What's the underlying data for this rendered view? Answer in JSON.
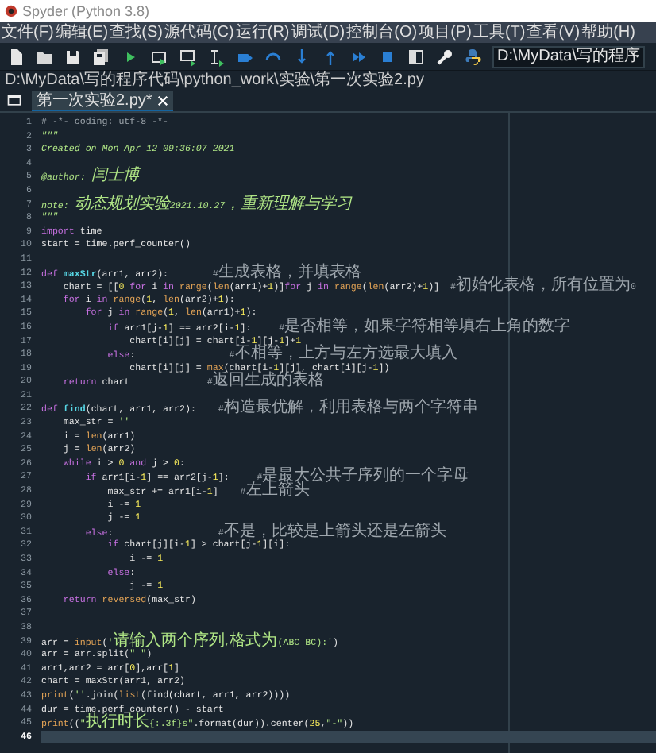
{
  "window": {
    "title": "Spyder (Python 3.8)"
  },
  "menu": [
    "文件(F)",
    "编辑(E)",
    "查找(S)",
    "源代码(C)",
    "运行(R)",
    "调试(D)",
    "控制台(O)",
    "项目(P)",
    "工具(T)",
    "查看(V)",
    "帮助(H)"
  ],
  "toolbar": {
    "working_directory": "D:\\MyData\\写的程序"
  },
  "file_path": "D:\\MyData\\写的程序代码\\python_work\\实验\\第一次实验2.py",
  "tabs": [
    {
      "label": "第一次实验2.py*",
      "selected": true
    }
  ],
  "editor": {
    "lines": [
      {
        "number": "1",
        "current": false,
        "tokens": [
          {
            "kind": "comment",
            "text": "# -*- coding: utf-8 -*-"
          }
        ]
      },
      {
        "number": "2",
        "current": false,
        "tokens": [
          {
            "kind": "docstring",
            "text": "\"\"\""
          }
        ]
      },
      {
        "number": "3",
        "current": false,
        "tokens": [
          {
            "kind": "docstring",
            "text": "Created on Mon Apr 12 09:36:07 2021"
          }
        ]
      },
      {
        "number": "4",
        "current": false
      },
      {
        "number": "5",
        "current": false,
        "tokens": [
          {
            "kind": "docstring",
            "text": "@author: 闫士博"
          }
        ]
      },
      {
        "number": "6",
        "current": false
      },
      {
        "number": "7",
        "current": false,
        "tokens": [
          {
            "kind": "docstring",
            "text": "note: 动态规划实验2021.10.27，重新理解与学习"
          }
        ]
      },
      {
        "number": "8",
        "current": false,
        "tokens": [
          {
            "kind": "docstring",
            "text": "\"\"\""
          }
        ]
      },
      {
        "number": "9",
        "current": false,
        "tokens": [
          {
            "kind": "keyword",
            "text": "import"
          },
          {
            "kind": "plain",
            "text": " time"
          }
        ]
      },
      {
        "number": "10",
        "current": false,
        "tokens": [
          {
            "kind": "plain",
            "text": "start = time.perf_counter()"
          }
        ]
      },
      {
        "number": "11",
        "current": false
      },
      {
        "number": "12",
        "current": false,
        "tokens": [
          {
            "kind": "keyword",
            "text": "def "
          },
          {
            "kind": "function",
            "text": "maxStr"
          },
          {
            "kind": "plain",
            "text": "(arr1, arr2):        "
          },
          {
            "kind": "comment",
            "text": "#生成表格，并填表格"
          }
        ]
      },
      {
        "number": "13",
        "current": false,
        "tokens": [
          {
            "kind": "plain",
            "text": "    chart = [["
          },
          {
            "kind": "number",
            "text": "0"
          },
          {
            "kind": "keyword",
            "text": " for"
          },
          {
            "kind": "plain",
            "text": " i "
          },
          {
            "kind": "keyword",
            "text": "in"
          },
          {
            "kind": "builtin",
            "text": " range"
          },
          {
            "kind": "plain",
            "text": "("
          },
          {
            "kind": "builtin",
            "text": "len"
          },
          {
            "kind": "plain",
            "text": "(arr1)+"
          },
          {
            "kind": "number",
            "text": "1"
          },
          {
            "kind": "plain",
            "text": ")]"
          },
          {
            "kind": "keyword",
            "text": "for"
          },
          {
            "kind": "plain",
            "text": " j "
          },
          {
            "kind": "keyword",
            "text": "in"
          },
          {
            "kind": "builtin",
            "text": " range"
          },
          {
            "kind": "plain",
            "text": "("
          },
          {
            "kind": "builtin",
            "text": "len"
          },
          {
            "kind": "plain",
            "text": "(arr2)+"
          },
          {
            "kind": "number",
            "text": "1"
          },
          {
            "kind": "plain",
            "text": ")]  "
          },
          {
            "kind": "comment",
            "text": "#初始化表格，所有位置为0"
          }
        ]
      },
      {
        "number": "14",
        "current": false,
        "tokens": [
          {
            "kind": "keyword",
            "text": "    for"
          },
          {
            "kind": "plain",
            "text": " i "
          },
          {
            "kind": "keyword",
            "text": "in"
          },
          {
            "kind": "builtin",
            "text": " range"
          },
          {
            "kind": "plain",
            "text": "("
          },
          {
            "kind": "number",
            "text": "1"
          },
          {
            "kind": "plain",
            "text": ", "
          },
          {
            "kind": "builtin",
            "text": "len"
          },
          {
            "kind": "plain",
            "text": "(arr2)+"
          },
          {
            "kind": "number",
            "text": "1"
          },
          {
            "kind": "plain",
            "text": "):"
          }
        ]
      },
      {
        "number": "15",
        "current": false,
        "tokens": [
          {
            "kind": "keyword",
            "text": "        for"
          },
          {
            "kind": "plain",
            "text": " j "
          },
          {
            "kind": "keyword",
            "text": "in"
          },
          {
            "kind": "builtin",
            "text": " range"
          },
          {
            "kind": "plain",
            "text": "("
          },
          {
            "kind": "number",
            "text": "1"
          },
          {
            "kind": "plain",
            "text": ", "
          },
          {
            "kind": "builtin",
            "text": "len"
          },
          {
            "kind": "plain",
            "text": "(arr1)+"
          },
          {
            "kind": "number",
            "text": "1"
          },
          {
            "kind": "plain",
            "text": "):"
          }
        ]
      },
      {
        "number": "16",
        "current": false,
        "tokens": [
          {
            "kind": "keyword",
            "text": "            if"
          },
          {
            "kind": "plain",
            "text": " arr1[j-"
          },
          {
            "kind": "number",
            "text": "1"
          },
          {
            "kind": "plain",
            "text": "] == arr2[i-"
          },
          {
            "kind": "number",
            "text": "1"
          },
          {
            "kind": "plain",
            "text": "]:     "
          },
          {
            "kind": "comment",
            "text": "#是否相等，如果字符相等填右上角的数字"
          }
        ]
      },
      {
        "number": "17",
        "current": false,
        "tokens": [
          {
            "kind": "plain",
            "text": "                chart[i][j] = chart[i-"
          },
          {
            "kind": "number",
            "text": "1"
          },
          {
            "kind": "plain",
            "text": "][j-"
          },
          {
            "kind": "number",
            "text": "1"
          },
          {
            "kind": "plain",
            "text": "]+"
          },
          {
            "kind": "number",
            "text": "1"
          }
        ]
      },
      {
        "number": "18",
        "current": false,
        "tokens": [
          {
            "kind": "keyword",
            "text": "            else"
          },
          {
            "kind": "plain",
            "text": ":                 "
          },
          {
            "kind": "comment",
            "text": "#不相等，上方与左方选最大填入"
          }
        ]
      },
      {
        "number": "19",
        "current": false,
        "tokens": [
          {
            "kind": "plain",
            "text": "                chart[i][j] = "
          },
          {
            "kind": "builtin",
            "text": "max"
          },
          {
            "kind": "plain",
            "text": "(chart[i-"
          },
          {
            "kind": "number",
            "text": "1"
          },
          {
            "kind": "plain",
            "text": "][j], chart[i][j-"
          },
          {
            "kind": "number",
            "text": "1"
          },
          {
            "kind": "plain",
            "text": "])"
          }
        ]
      },
      {
        "number": "20",
        "current": false,
        "tokens": [
          {
            "kind": "keyword",
            "text": "    return"
          },
          {
            "kind": "plain",
            "text": " chart              "
          },
          {
            "kind": "comment",
            "text": "#返回生成的表格"
          }
        ]
      },
      {
        "number": "21",
        "current": false
      },
      {
        "number": "22",
        "current": false,
        "tokens": [
          {
            "kind": "keyword",
            "text": "def "
          },
          {
            "kind": "function",
            "text": "find"
          },
          {
            "kind": "plain",
            "text": "(chart, arr1, arr2):    "
          },
          {
            "kind": "comment",
            "text": "#构造最优解，利用表格与两个字符串"
          }
        ]
      },
      {
        "number": "23",
        "current": false,
        "tokens": [
          {
            "kind": "plain",
            "text": "    max_str = "
          },
          {
            "kind": "string",
            "text": "''"
          }
        ]
      },
      {
        "number": "24",
        "current": false,
        "tokens": [
          {
            "kind": "plain",
            "text": "    i = "
          },
          {
            "kind": "builtin",
            "text": "len"
          },
          {
            "kind": "plain",
            "text": "(arr1)"
          }
        ]
      },
      {
        "number": "25",
        "current": false,
        "tokens": [
          {
            "kind": "plain",
            "text": "    j = "
          },
          {
            "kind": "builtin",
            "text": "len"
          },
          {
            "kind": "plain",
            "text": "(arr2)"
          }
        ]
      },
      {
        "number": "26",
        "current": false,
        "tokens": [
          {
            "kind": "keyword",
            "text": "    while"
          },
          {
            "kind": "plain",
            "text": " i > "
          },
          {
            "kind": "number",
            "text": "0"
          },
          {
            "kind": "keyword",
            "text": " and"
          },
          {
            "kind": "plain",
            "text": " j > "
          },
          {
            "kind": "number",
            "text": "0"
          },
          {
            "kind": "plain",
            "text": ":"
          }
        ]
      },
      {
        "number": "27",
        "current": false,
        "tokens": [
          {
            "kind": "keyword",
            "text": "        if"
          },
          {
            "kind": "plain",
            "text": " arr1[i-"
          },
          {
            "kind": "number",
            "text": "1"
          },
          {
            "kind": "plain",
            "text": "] == arr2[j-"
          },
          {
            "kind": "number",
            "text": "1"
          },
          {
            "kind": "plain",
            "text": "]:     "
          },
          {
            "kind": "comment",
            "text": "#是最大公共子序列的一个字母"
          }
        ]
      },
      {
        "number": "28",
        "current": false,
        "tokens": [
          {
            "kind": "plain",
            "text": "            max_str += arr1[i-"
          },
          {
            "kind": "number",
            "text": "1"
          },
          {
            "kind": "plain",
            "text": "]    "
          },
          {
            "kind": "comment",
            "text": "#左上箭头"
          }
        ]
      },
      {
        "number": "29",
        "current": false,
        "tokens": [
          {
            "kind": "plain",
            "text": "            i -= "
          },
          {
            "kind": "number",
            "text": "1"
          }
        ]
      },
      {
        "number": "30",
        "current": false,
        "tokens": [
          {
            "kind": "plain",
            "text": "            j -= "
          },
          {
            "kind": "number",
            "text": "1"
          }
        ]
      },
      {
        "number": "31",
        "current": false,
        "tokens": [
          {
            "kind": "keyword",
            "text": "        else"
          },
          {
            "kind": "plain",
            "text": ":                   "
          },
          {
            "kind": "comment",
            "text": "#不是，比较是上箭头还是左箭头"
          }
        ]
      },
      {
        "number": "32",
        "current": false,
        "tokens": [
          {
            "kind": "keyword",
            "text": "            if"
          },
          {
            "kind": "plain",
            "text": " chart[j][i-"
          },
          {
            "kind": "number",
            "text": "1"
          },
          {
            "kind": "plain",
            "text": "] > chart[j-"
          },
          {
            "kind": "number",
            "text": "1"
          },
          {
            "kind": "plain",
            "text": "][i]:"
          }
        ]
      },
      {
        "number": "33",
        "current": false,
        "tokens": [
          {
            "kind": "plain",
            "text": "                i -= "
          },
          {
            "kind": "number",
            "text": "1"
          }
        ]
      },
      {
        "number": "34",
        "current": false,
        "tokens": [
          {
            "kind": "keyword",
            "text": "            else"
          },
          {
            "kind": "plain",
            "text": ":"
          }
        ]
      },
      {
        "number": "35",
        "current": false,
        "tokens": [
          {
            "kind": "plain",
            "text": "                j -= "
          },
          {
            "kind": "number",
            "text": "1"
          }
        ]
      },
      {
        "number": "36",
        "current": false,
        "tokens": [
          {
            "kind": "keyword",
            "text": "    return"
          },
          {
            "kind": "builtin",
            "text": " reversed"
          },
          {
            "kind": "plain",
            "text": "(max_str)"
          }
        ]
      },
      {
        "number": "37",
        "current": false
      },
      {
        "number": "38",
        "current": false
      },
      {
        "number": "39",
        "current": false,
        "tokens": [
          {
            "kind": "plain",
            "text": "arr = "
          },
          {
            "kind": "builtin",
            "text": "input"
          },
          {
            "kind": "plain",
            "text": "("
          },
          {
            "kind": "string",
            "text": "'请输入两个序列,格式为(ABC BC):'"
          },
          {
            "kind": "plain",
            "text": ")"
          }
        ]
      },
      {
        "number": "40",
        "current": false,
        "tokens": [
          {
            "kind": "plain",
            "text": "arr = arr.split("
          },
          {
            "kind": "string",
            "text": "\" \""
          },
          {
            "kind": "plain",
            "text": ")"
          }
        ]
      },
      {
        "number": "41",
        "current": false,
        "tokens": [
          {
            "kind": "plain",
            "text": "arr1,arr2 = arr["
          },
          {
            "kind": "number",
            "text": "0"
          },
          {
            "kind": "plain",
            "text": "],arr["
          },
          {
            "kind": "number",
            "text": "1"
          },
          {
            "kind": "plain",
            "text": "]"
          }
        ]
      },
      {
        "number": "42",
        "current": false,
        "tokens": [
          {
            "kind": "plain",
            "text": "chart = maxStr(arr1, arr2)"
          }
        ]
      },
      {
        "number": "43",
        "current": false,
        "tokens": [
          {
            "kind": "builtin",
            "text": "print"
          },
          {
            "kind": "plain",
            "text": "("
          },
          {
            "kind": "string",
            "text": "''"
          },
          {
            "kind": "plain",
            "text": ".join("
          },
          {
            "kind": "builtin",
            "text": "list"
          },
          {
            "kind": "plain",
            "text": "(find(chart, arr1, arr2))))"
          }
        ]
      },
      {
        "number": "44",
        "current": false,
        "tokens": [
          {
            "kind": "plain",
            "text": "dur = time.perf_counter() - start"
          }
        ]
      },
      {
        "number": "45",
        "current": false,
        "tokens": [
          {
            "kind": "builtin",
            "text": "print"
          },
          {
            "kind": "plain",
            "text": "(("
          },
          {
            "kind": "string",
            "text": "\"执行时长{:.3f}s\""
          },
          {
            "kind": "plain",
            "text": ".format(dur)).center("
          },
          {
            "kind": "number",
            "text": "25"
          },
          {
            "kind": "plain",
            "text": ","
          },
          {
            "kind": "string",
            "text": "\"-\""
          },
          {
            "kind": "plain",
            "text": "))"
          }
        ]
      },
      {
        "number": "46",
        "current": true
      }
    ]
  }
}
